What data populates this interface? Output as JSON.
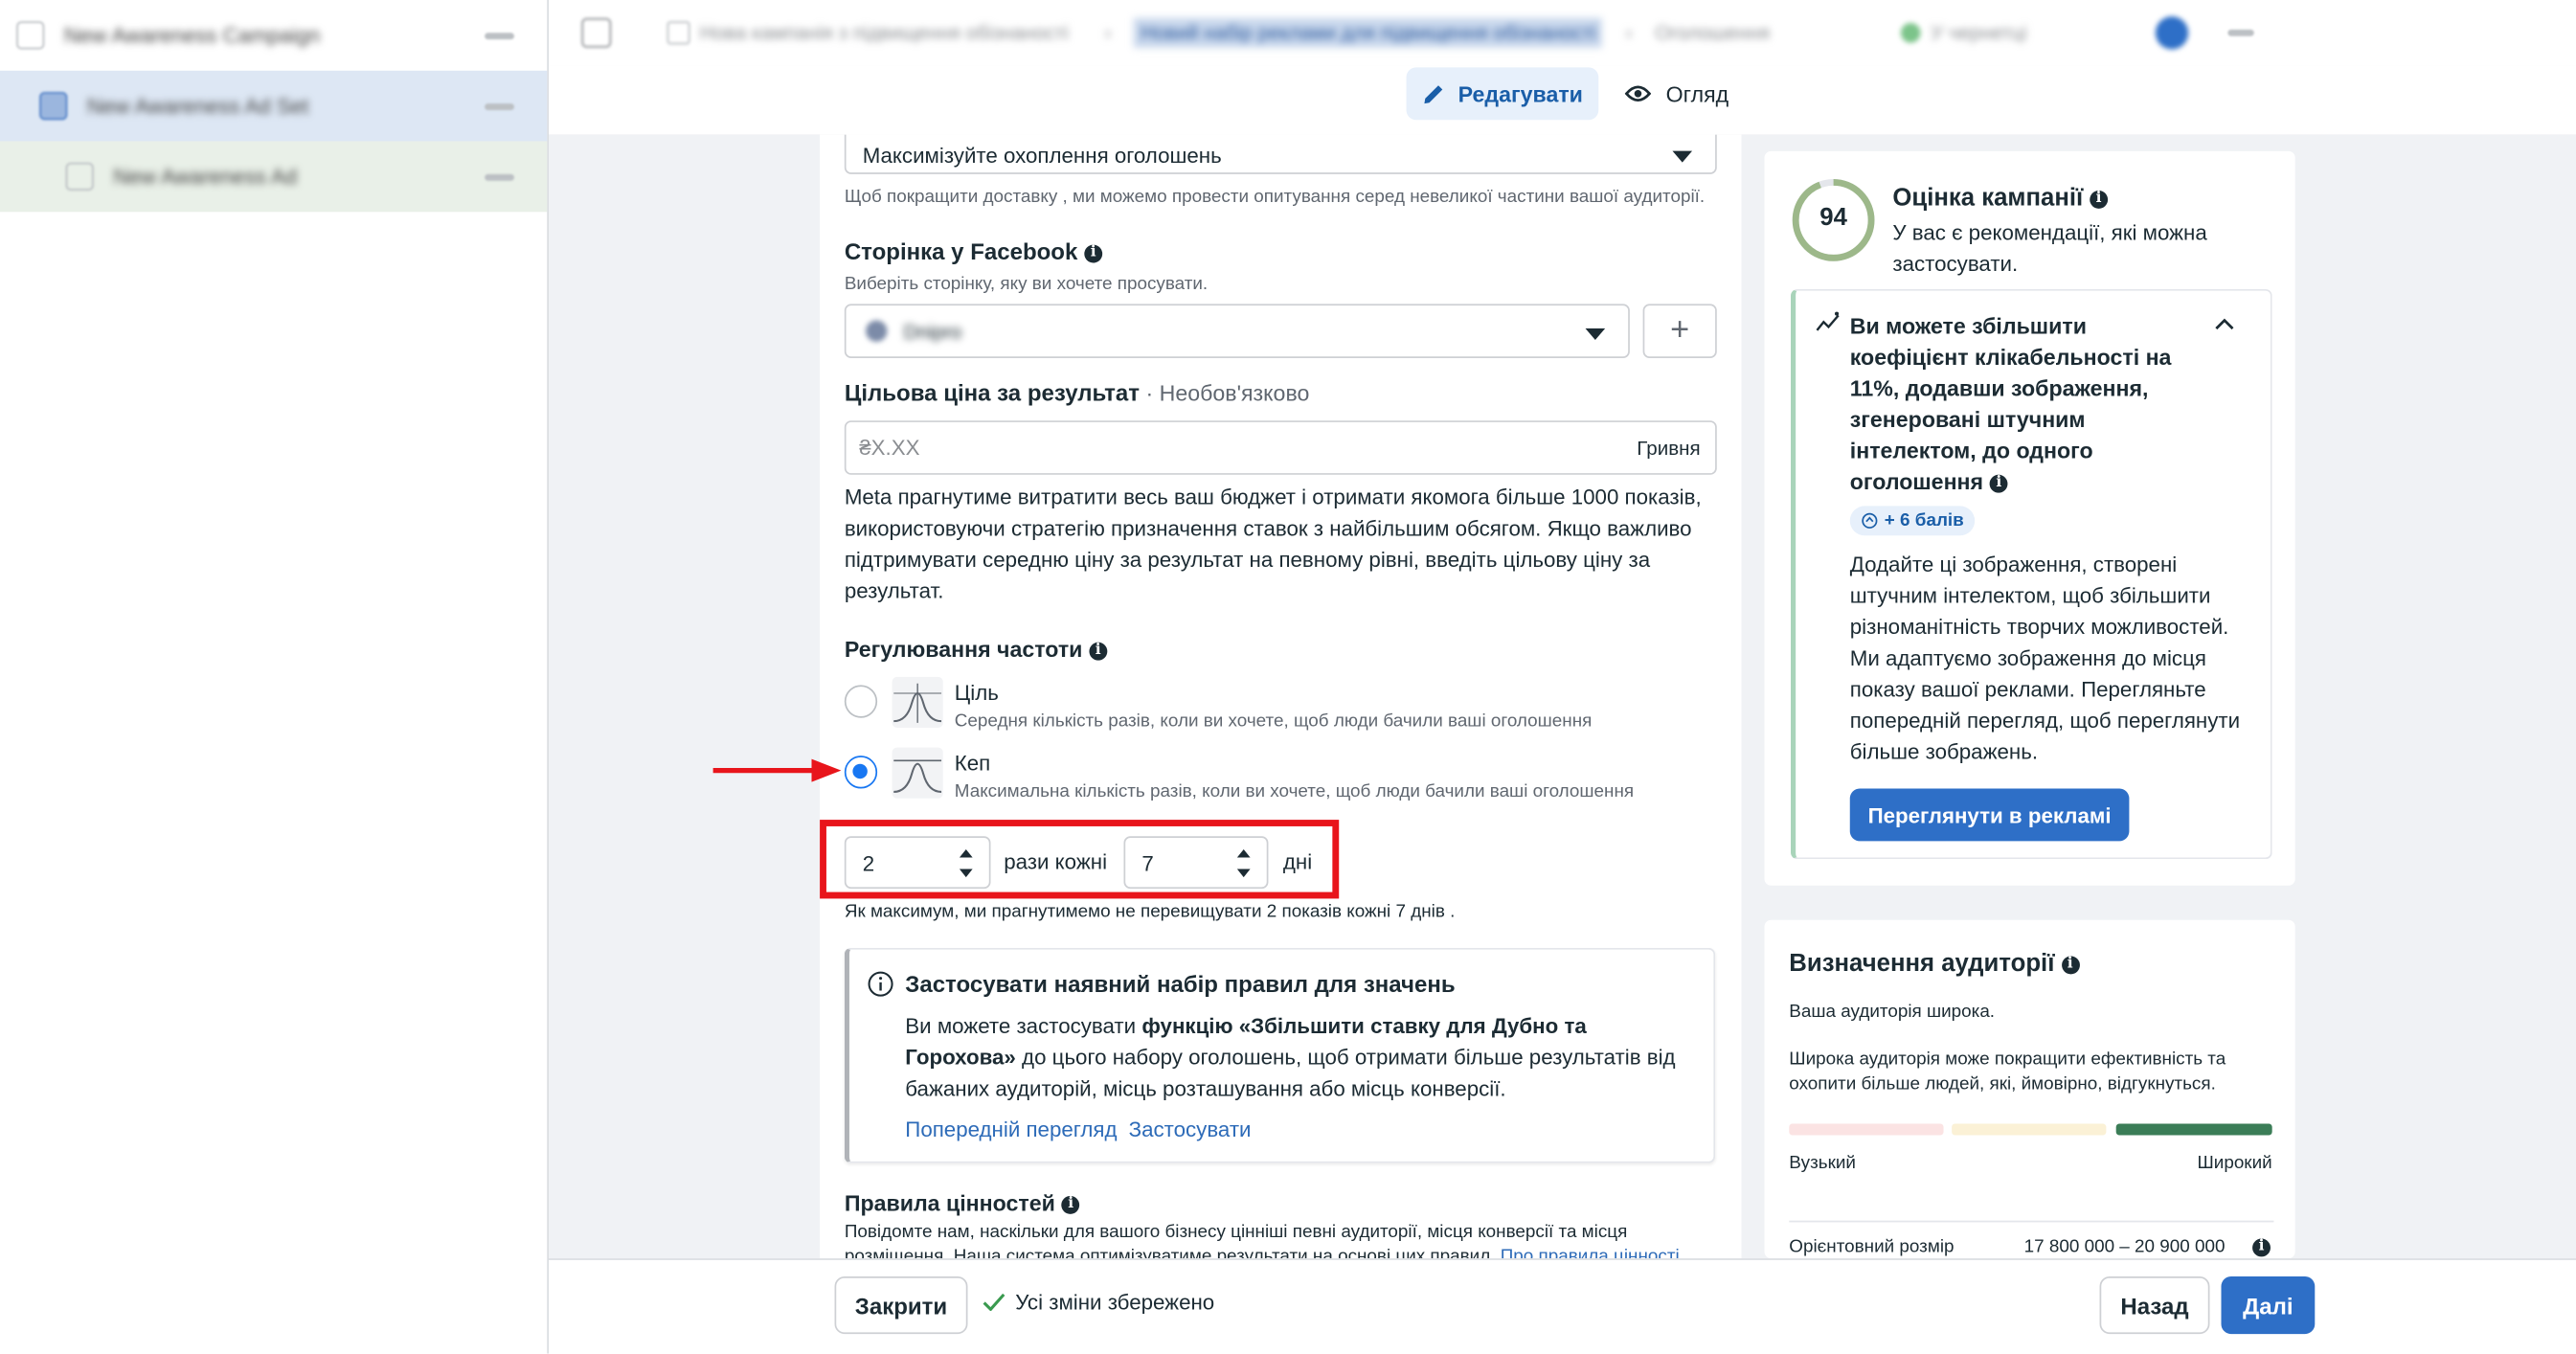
{
  "tree": {
    "items": [
      {
        "label": "New Awareness Campaign"
      },
      {
        "label": "New Awareness Ad Set"
      },
      {
        "label": "New Awareness Ad"
      }
    ]
  },
  "topbar": {
    "crumb1": "Нова кампанія з підвищення обізнаності",
    "crumb2": "Новий набір реклами для підвищення обізнаності",
    "crumb3": "Оголошення",
    "status": "У чернетці"
  },
  "mode": {
    "edit": "Редагувати",
    "review": "Огляд"
  },
  "form": {
    "delivery_select": "Максимізуйте охоплення оголошень",
    "delivery_hint": "Щоб покращити доставку , ми можемо провести опитування серед невеликої частини вашої аудиторії.",
    "fb_page_title": "Сторінка у Facebook",
    "fb_page_hint": "Виберіть сторінку, яку ви хочете просувати.",
    "fb_page_value": "Dnipro",
    "target_cost_title": "Цільова ціна за результат",
    "target_cost_optional": " · Необов'язково",
    "target_cost_placeholder": "₴X.XX",
    "target_cost_currency": "Гривня",
    "target_cost_desc": "Meta прагнутиме витратити весь ваш бюджет і отримати якомога більше 1000 показів, використовуючи стратегію призначення ставок з найбільшим обсягом. Якщо важливо підтримувати середню ціну за результат на певному рівні, введіть цільову ціну за результат.",
    "freq_title": "Регулювання частоти",
    "freq_options": [
      {
        "label": "Ціль",
        "desc": "Середня кількість разів, коли ви хочете, щоб люди бачили ваші оголошення",
        "selected": false
      },
      {
        "label": "Кеп",
        "desc": "Максимальна кількість разів, коли ви хочете, щоб люди бачили ваші оголошення",
        "selected": true
      }
    ],
    "freq_times": "2",
    "freq_times_label": "рази кожні",
    "freq_days": "7",
    "freq_days_label": "дні",
    "freq_note": "Як максимум, ми прагнутимемо не перевищувати 2 показів кожні 7 днів .",
    "rules_title": "Застосувати наявний набір правил для значень",
    "rules_text_pre": "Ви можете застосувати ",
    "rules_text_bold": "функцію «Збільшити ставку для Дубно та Горохова»",
    "rules_text_post": " до цього набору оголошень, щоб отримати більше результатів від бажаних аудиторій, місць розташування або місць конверсії.",
    "rules_preview": "Попередній перегляд",
    "rules_apply": "Застосувати",
    "value_rules_title": "Правила цінностей",
    "value_rules_text": "Повідомте нам, наскільки для вашого бізнесу цінніші певні аудиторії, місця конверсії та місця розміщення. Наша система оптимізуватиме результати на основі цих правил.",
    "value_rules_link": "Про правила цінності"
  },
  "score": {
    "value": "94",
    "title": "Оцінка кампанії",
    "subtitle": "У вас є рекомендації, які можна застосувати.",
    "rec_title": "Ви можете збільшити коефіцієнт клікабельності на 11%, додавши зображення, згенеровані штучним інтелектом, до одного оголошення",
    "rec_points": "+ 6 балів",
    "rec_body": "Додайте ці зображення, створені штучним інтелектом, щоб збільшити різноманітність творчих можливостей. Ми адаптуємо зображення до місця показу вашої реклами. Перегляньте попередній перегляд, щоб переглянути більше зображень.",
    "rec_button": "Переглянути в рекламі"
  },
  "audience": {
    "title": "Визначення аудиторії",
    "line1": "Ваша аудиторія широка.",
    "line2": "Широка аудиторія може покращити ефективність та охопити більше людей, які, ймовірно, відгукнуться.",
    "narrow": "Вузький",
    "broad": "Широкий",
    "size_label": "Орієнтовний розмір",
    "size_value": "17 800 000 – 20 900 000"
  },
  "bottom": {
    "close": "Закрити",
    "saved": "Усі зміни збережено",
    "back": "Назад",
    "next": "Далі"
  },
  "colors": {
    "accent": "#2e6fc7",
    "annotation_red": "#e8151b",
    "score_green": "#9db88a",
    "rec_border": "#a9d4ba"
  }
}
